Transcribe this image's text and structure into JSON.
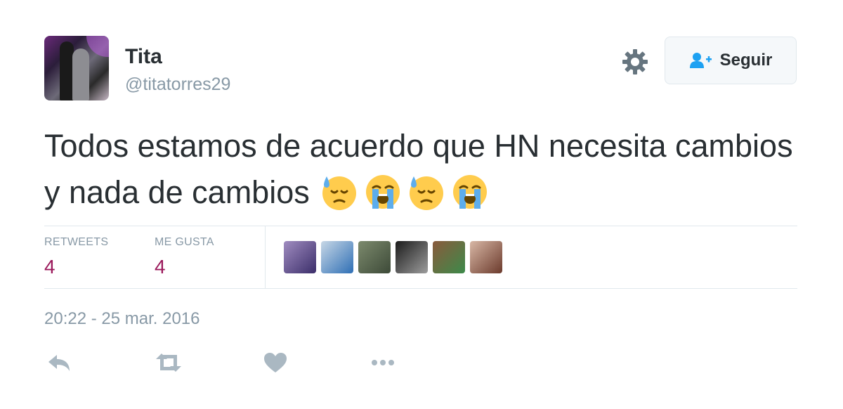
{
  "user": {
    "name": "Tita",
    "handle": "@titatorres29"
  },
  "follow_button": {
    "label": "Seguir"
  },
  "tweet": {
    "text": "Todos estamos de acuerdo que HN necesita cambios y nada de cambios"
  },
  "emojis": [
    "downcast-face-with-sweat",
    "loudly-crying-face",
    "downcast-face-with-sweat",
    "loudly-crying-face"
  ],
  "stats": [
    {
      "label": "RETWEETS",
      "value": "4"
    },
    {
      "label": "ME GUSTA",
      "value": "4"
    }
  ],
  "likers": [
    {
      "colors": [
        "#a08cc0",
        "#3b2e6a"
      ]
    },
    {
      "colors": [
        "#c7d7e6",
        "#2f6fb5"
      ]
    },
    {
      "colors": [
        "#7c8a6d",
        "#3d4a38"
      ]
    },
    {
      "colors": [
        "#1b1b1b",
        "#9d9d9d"
      ]
    },
    {
      "colors": [
        "#8a5a3c",
        "#3c8a4a"
      ]
    },
    {
      "colors": [
        "#d8b7a5",
        "#6b3a2c"
      ]
    }
  ],
  "timestamp": "20:22 - 25 mar. 2016",
  "actions": [
    "reply-icon",
    "retweet-icon",
    "heart-icon",
    "more-icon"
  ],
  "colors": {
    "stat_value": "#9b1a5c",
    "muted": "#8899a6",
    "text": "#292f33",
    "follow_icon": "#1da1f2"
  }
}
